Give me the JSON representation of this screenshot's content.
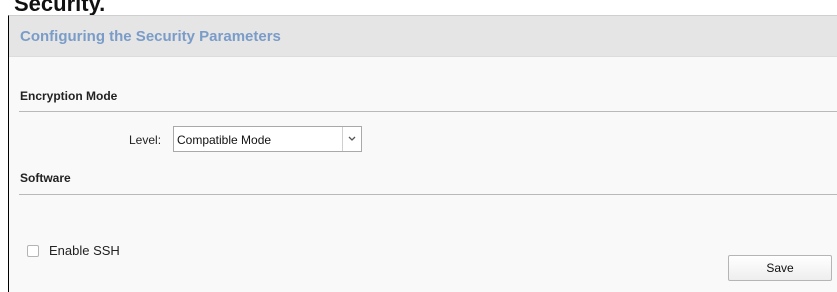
{
  "page": {
    "cut_heading": "Security."
  },
  "panel": {
    "title": "Configuring the Security Parameters"
  },
  "encryption": {
    "section_title": "Encryption Mode",
    "level_label": "Level:",
    "level_value": "Compatible Mode"
  },
  "software": {
    "section_title": "Software",
    "ssh_label": "Enable SSH",
    "ssh_enabled": false
  },
  "actions": {
    "save_label": "Save"
  },
  "colors": {
    "title_blue": "#7a9cc8",
    "header_bg": "#e5e5e5",
    "panel_bg": "#f9f9f9",
    "divider": "#b9b9b9"
  },
  "icons": {
    "dropdown": "chevron-down-icon"
  }
}
